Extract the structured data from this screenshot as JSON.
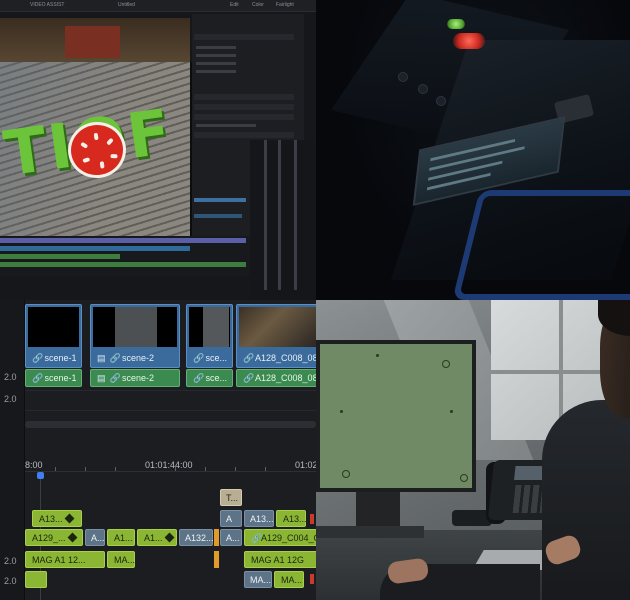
{
  "top_left": {
    "topbar_items": [
      "VIDEO ASSIST",
      "Untitled",
      "Edit",
      "Color",
      "Fairlight"
    ],
    "brand_sign": "TIOF"
  },
  "bottom_left": {
    "track_labels": [
      "2.0",
      "2.0",
      "2.0",
      "2.0"
    ],
    "video_clips": [
      {
        "label": "scene-1",
        "icon": "link-icon"
      },
      {
        "label": "scene-2",
        "icon": "link-icon"
      },
      {
        "label": "sce...",
        "icon": "link-icon"
      },
      {
        "label": "A128_C008_08",
        "icon": "link-icon"
      }
    ],
    "audio_clips": [
      {
        "label": "scene-1"
      },
      {
        "label": "scene-2"
      },
      {
        "label": "sce..."
      },
      {
        "label": "A128_C008_08"
      }
    ],
    "timecodes": [
      "8:00",
      "01:01:44:00",
      "01:02"
    ],
    "row_a": [
      "A13...",
      "A13...",
      "A13..."
    ],
    "row_b": [
      "A129_...",
      "A...",
      "A1...",
      "A1...",
      "A132...",
      "A...",
      "A129_C004_C"
    ],
    "row_c": [
      "MAG A1 12...",
      "MA...",
      "MAG A1 12G"
    ],
    "row_d": [
      "MA...",
      "MA..."
    ],
    "title_clip": "T..."
  },
  "colors": {
    "video_clip": "#3a6b9c",
    "audio_clip": "#3b8a50",
    "green_clip": "#8ab634",
    "playhead": "#3f7ff0",
    "led_red": "#c7271c",
    "led_green": "#4b9a2a",
    "monitor_green": "#6f8a64"
  }
}
